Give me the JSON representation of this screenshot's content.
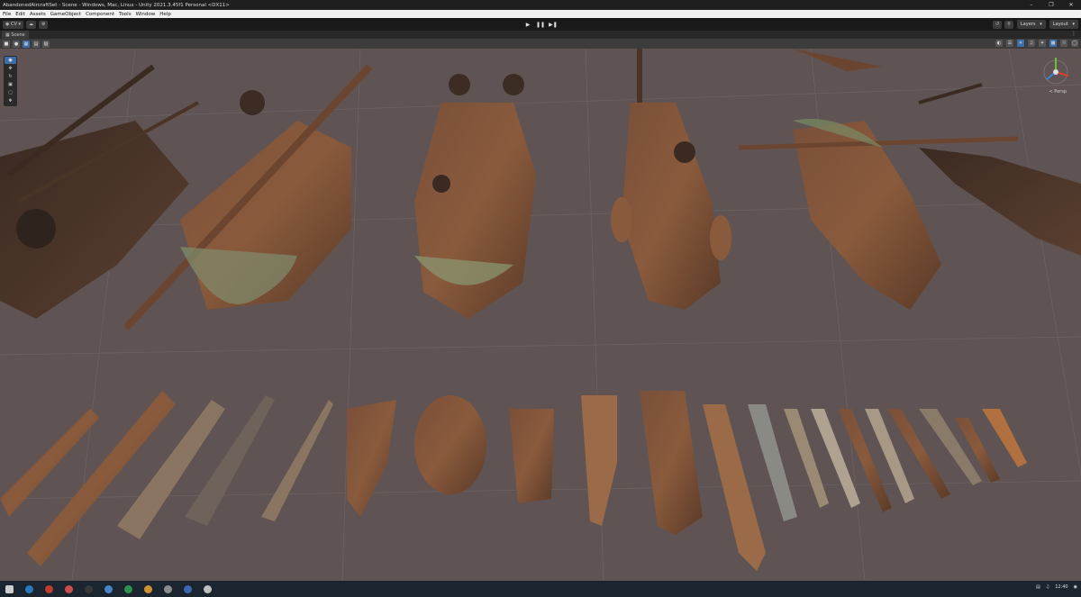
{
  "window": {
    "title": "AbandonedAircraftSet - Scene - Windows, Mac, Linux - Unity 2021.3.45f1 Personal <DX11>",
    "minimize": "–",
    "maximize": "❐",
    "close": "✕"
  },
  "menu": [
    "File",
    "Edit",
    "Assets",
    "GameObject",
    "Component",
    "Tools",
    "Window",
    "Help"
  ],
  "toolbar": {
    "account": "CV",
    "layers": "Layers",
    "layout": "Layout"
  },
  "scene_tab": {
    "label": "Scene"
  },
  "viewport": {
    "persp_label": "< Persp"
  },
  "taskbar": {
    "time": "12:40"
  },
  "colors": {
    "ground": "#5f5453",
    "rust": "#8a5a3c",
    "vine": "#6f7f58"
  }
}
